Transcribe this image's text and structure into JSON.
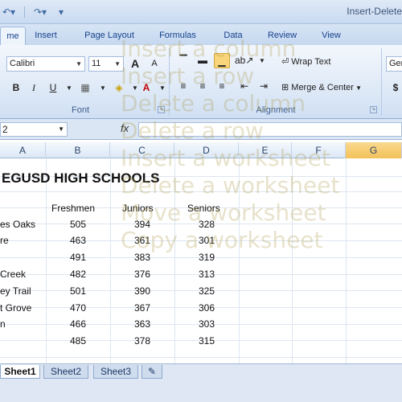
{
  "window": {
    "title": "Insert-Delete"
  },
  "qat": {
    "undo_icon": "undo-icon",
    "redo_icon": "redo-icon"
  },
  "tabs": [
    {
      "label": "me",
      "active": true
    },
    {
      "label": "Insert"
    },
    {
      "label": "Page Layout"
    },
    {
      "label": "Formulas"
    },
    {
      "label": "Data"
    },
    {
      "label": "Review"
    },
    {
      "label": "View"
    }
  ],
  "ribbon": {
    "font_name": "Calibri",
    "font_size": "11",
    "grow_font": "A",
    "shrink_font": "A",
    "bold": "B",
    "italic": "I",
    "underline": "U",
    "font_color": "A",
    "font_group": "Font",
    "wrap_text": "Wrap Text",
    "merge_center": "Merge & Center",
    "alignment_group": "Alignment",
    "number_format": "Ger",
    "currency": "$"
  },
  "formula_bar": {
    "name_box": "2",
    "fx": "fx"
  },
  "columns": [
    "A",
    "B",
    "C",
    "D",
    "E",
    "F",
    "G"
  ],
  "sheet": {
    "title": "EGUSD HIGH SCHOOLS",
    "headers": [
      "Freshmen",
      "Juniors",
      "Seniors"
    ],
    "rows": [
      {
        "name": "es Oaks",
        "b": "505",
        "c": "394",
        "d": "328"
      },
      {
        "name": "re",
        "b": "463",
        "c": "361",
        "d": "301"
      },
      {
        "name": "",
        "b": "491",
        "c": "383",
        "d": "319"
      },
      {
        "name": "Creek",
        "b": "482",
        "c": "376",
        "d": "313"
      },
      {
        "name": "ey Trail",
        "b": "501",
        "c": "390",
        "d": "325"
      },
      {
        "name": "t Grove",
        "b": "470",
        "c": "367",
        "d": "306"
      },
      {
        "name": "n",
        "b": "466",
        "c": "363",
        "d": "303"
      },
      {
        "name": "",
        "b": "485",
        "c": "378",
        "d": "315"
      }
    ]
  },
  "sheet_tabs": [
    "Sheet1",
    "Sheet2",
    "Sheet3"
  ],
  "watermark": [
    "Insert a column",
    "Insert a row",
    "Delete a column",
    "Delete a row",
    "Insert a worksheet",
    "Delete a worksheet",
    "Move a worksheet",
    "Copy a worksheet"
  ]
}
